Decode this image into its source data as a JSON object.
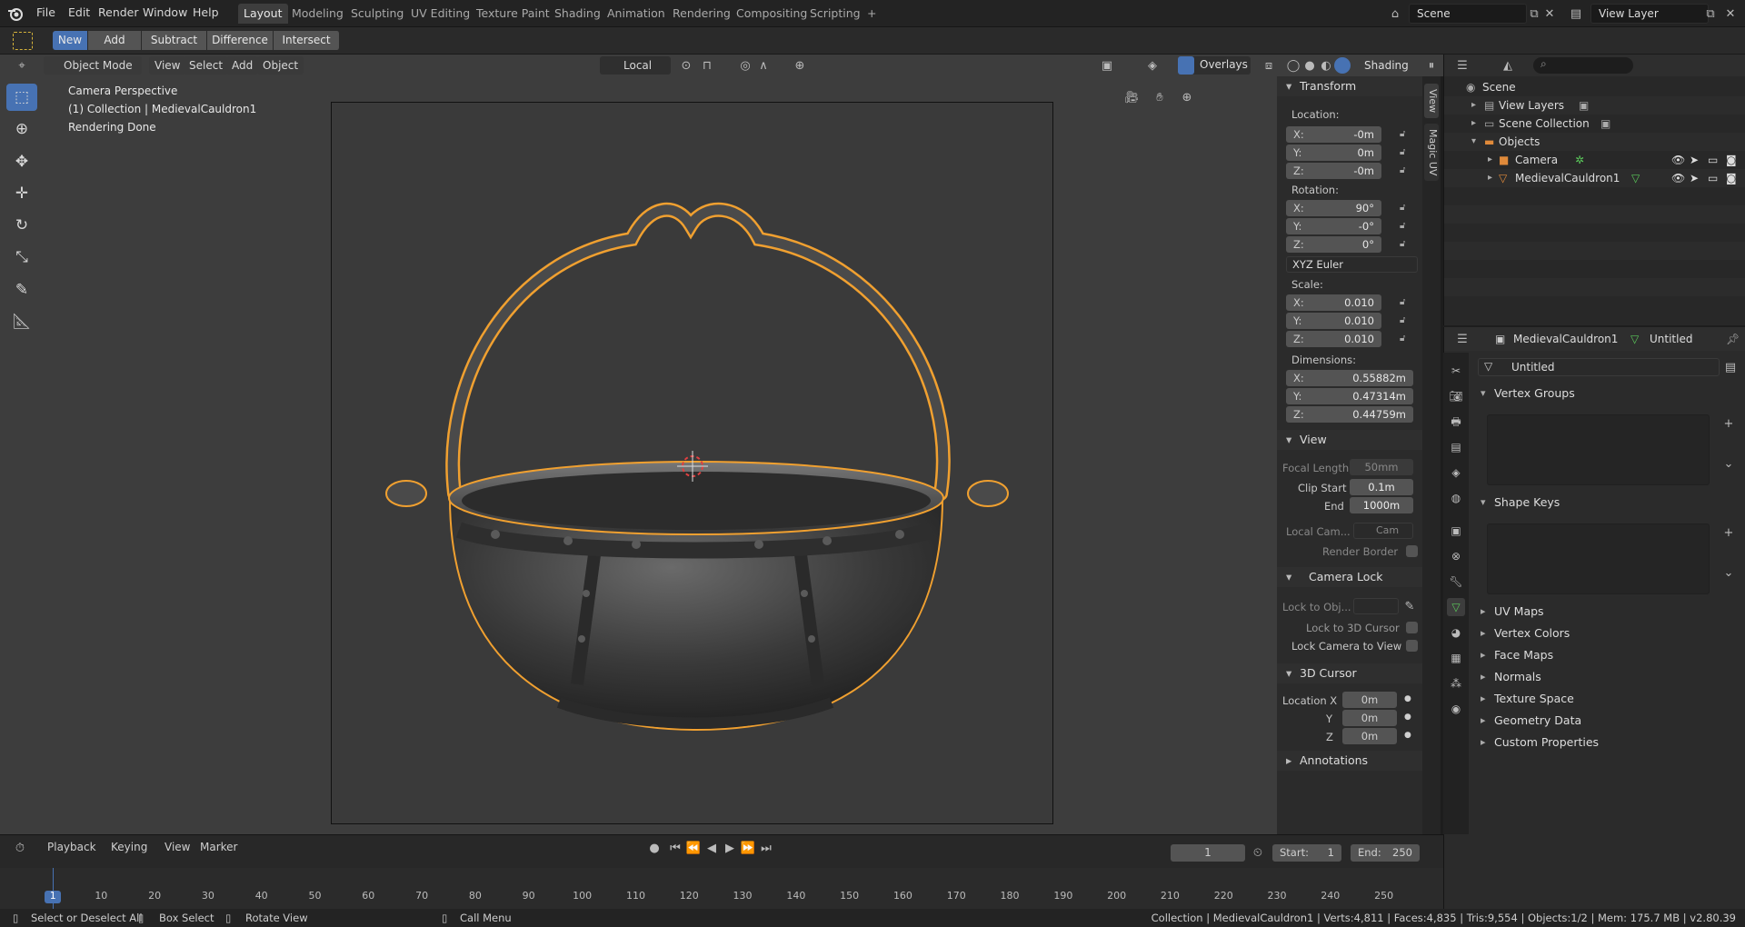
{
  "topbar": {
    "menus": [
      "File",
      "Edit",
      "Render",
      "Window",
      "Help"
    ],
    "workspaces": [
      "Layout",
      "Modeling",
      "Sculpting",
      "UV Editing",
      "Texture Paint",
      "Shading",
      "Animation",
      "Rendering",
      "Compositing",
      "Scripting"
    ],
    "active_workspace": "Layout",
    "add_tab": "+",
    "scene": "Scene",
    "view_layer": "View Layer"
  },
  "toolheader": {
    "bool_buttons": [
      "New",
      "Add",
      "Subtract",
      "Difference",
      "Intersect"
    ]
  },
  "viewport": {
    "mode": "Object Mode",
    "menus": [
      "View",
      "Select",
      "Add",
      "Object"
    ],
    "orientation": "Local",
    "overlays": "Overlays",
    "shading": "Shading",
    "info_lines": [
      "Camera Perspective",
      "(1) Collection | MedievalCauldron1",
      "Rendering Done"
    ]
  },
  "npanel": {
    "transform_title": "Transform",
    "location_label": "Location:",
    "location": [
      {
        "ax": "X:",
        "v": "-0m"
      },
      {
        "ax": "Y:",
        "v": "0m"
      },
      {
        "ax": "Z:",
        "v": "-0m"
      }
    ],
    "rotation_label": "Rotation:",
    "rotation": [
      {
        "ax": "X:",
        "v": "90°"
      },
      {
        "ax": "Y:",
        "v": "-0°"
      },
      {
        "ax": "Z:",
        "v": "0°"
      }
    ],
    "rotation_mode": "XYZ Euler",
    "scale_label": "Scale:",
    "scale": [
      {
        "ax": "X:",
        "v": "0.010"
      },
      {
        "ax": "Y:",
        "v": "0.010"
      },
      {
        "ax": "Z:",
        "v": "0.010"
      }
    ],
    "dimensions_label": "Dimensions:",
    "dimensions": [
      {
        "ax": "X:",
        "v": "0.55882m"
      },
      {
        "ax": "Y:",
        "v": "0.47314m"
      },
      {
        "ax": "Z:",
        "v": "0.44759m"
      }
    ],
    "view_title": "View",
    "focal_length_label": "Focal Length",
    "focal_length": "50mm",
    "clip_start_label": "Clip Start",
    "clip_start": "0.1m",
    "clip_end_label": "End",
    "clip_end": "1000m",
    "local_camera_label": "Local Cam...",
    "local_camera": "Cam",
    "render_border_label": "Render Border",
    "camera_lock_title": "Camera Lock",
    "lock_to_object_label": "Lock to Obj...",
    "lock_3d_cursor_label": "Lock to 3D Cursor",
    "lock_camera_label": "Lock Camera to View",
    "cursor_title": "3D Cursor",
    "cursor_location_label": "Location X",
    "cursor_y_label": "Y",
    "cursor_z_label": "Z",
    "cursor": [
      "0m",
      "0m",
      "0m"
    ],
    "annotations_title": "Annotations",
    "tabs": [
      "View",
      "Magic UV"
    ]
  },
  "outliner": {
    "rows": [
      {
        "label": "Scene",
        "indent": 0
      },
      {
        "label": "View Layers",
        "indent": 1
      },
      {
        "label": "Scene Collection",
        "indent": 1
      },
      {
        "label": "Objects",
        "indent": 1
      },
      {
        "label": "Camera",
        "indent": 2
      },
      {
        "label": "MedievalCauldron1",
        "indent": 2
      }
    ]
  },
  "properties": {
    "object_name": "MedievalCauldron1",
    "mesh_name": "Untitled",
    "data_name": "Untitled",
    "sections": [
      "Vertex Groups",
      "Shape Keys",
      "UV Maps",
      "Vertex Colors",
      "Face Maps",
      "Normals",
      "Texture Space",
      "Geometry Data",
      "Custom Properties"
    ]
  },
  "timeline": {
    "menus": [
      "Playback",
      "Keying",
      "View",
      "Marker"
    ],
    "current_frame": "1",
    "start_label": "Start:",
    "start": "1",
    "end_label": "End:",
    "end": "250",
    "ticks": [
      "1",
      "10",
      "20",
      "30",
      "40",
      "50",
      "60",
      "70",
      "80",
      "90",
      "100",
      "110",
      "120",
      "130",
      "140",
      "150",
      "160",
      "170",
      "180",
      "190",
      "200",
      "210",
      "220",
      "230",
      "240",
      "250"
    ]
  },
  "status": {
    "hint1": "Select or Deselect All",
    "hint2": "Box Select",
    "hint3": "Rotate View",
    "hint4": "Call Menu",
    "stats": "Collection | MedievalCauldron1 | Verts:4,811 | Faces:4,835 | Tris:9,554 | Objects:1/2 | Mem: 175.7 MB | v2.80.39"
  },
  "colors": {
    "accent": "#4772b3",
    "selection_outline": "#f0a030",
    "viewport_bg": "#3d3d3d"
  }
}
